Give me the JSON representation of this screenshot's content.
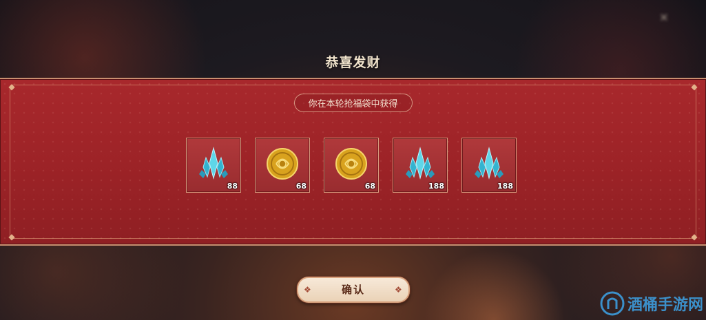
{
  "dialog": {
    "background_title": "",
    "title": "恭喜发财",
    "subtitle": "你在本轮抢福袋中获得",
    "confirm_label": "确认"
  },
  "rewards": [
    {
      "icon": "crystal-icon",
      "count": "88"
    },
    {
      "icon": "gold-coin-icon",
      "count": "68"
    },
    {
      "icon": "gold-coin-icon",
      "count": "68"
    },
    {
      "icon": "crystal-icon",
      "count": "188"
    },
    {
      "icon": "crystal-icon",
      "count": "188"
    }
  ],
  "watermark": {
    "text": "酒桶手游网"
  },
  "colors": {
    "panel_red": "#a8282c",
    "border_gold": "#d79a7d",
    "button_cream": "#f7e9d8",
    "watermark_blue": "#3da4e8"
  }
}
